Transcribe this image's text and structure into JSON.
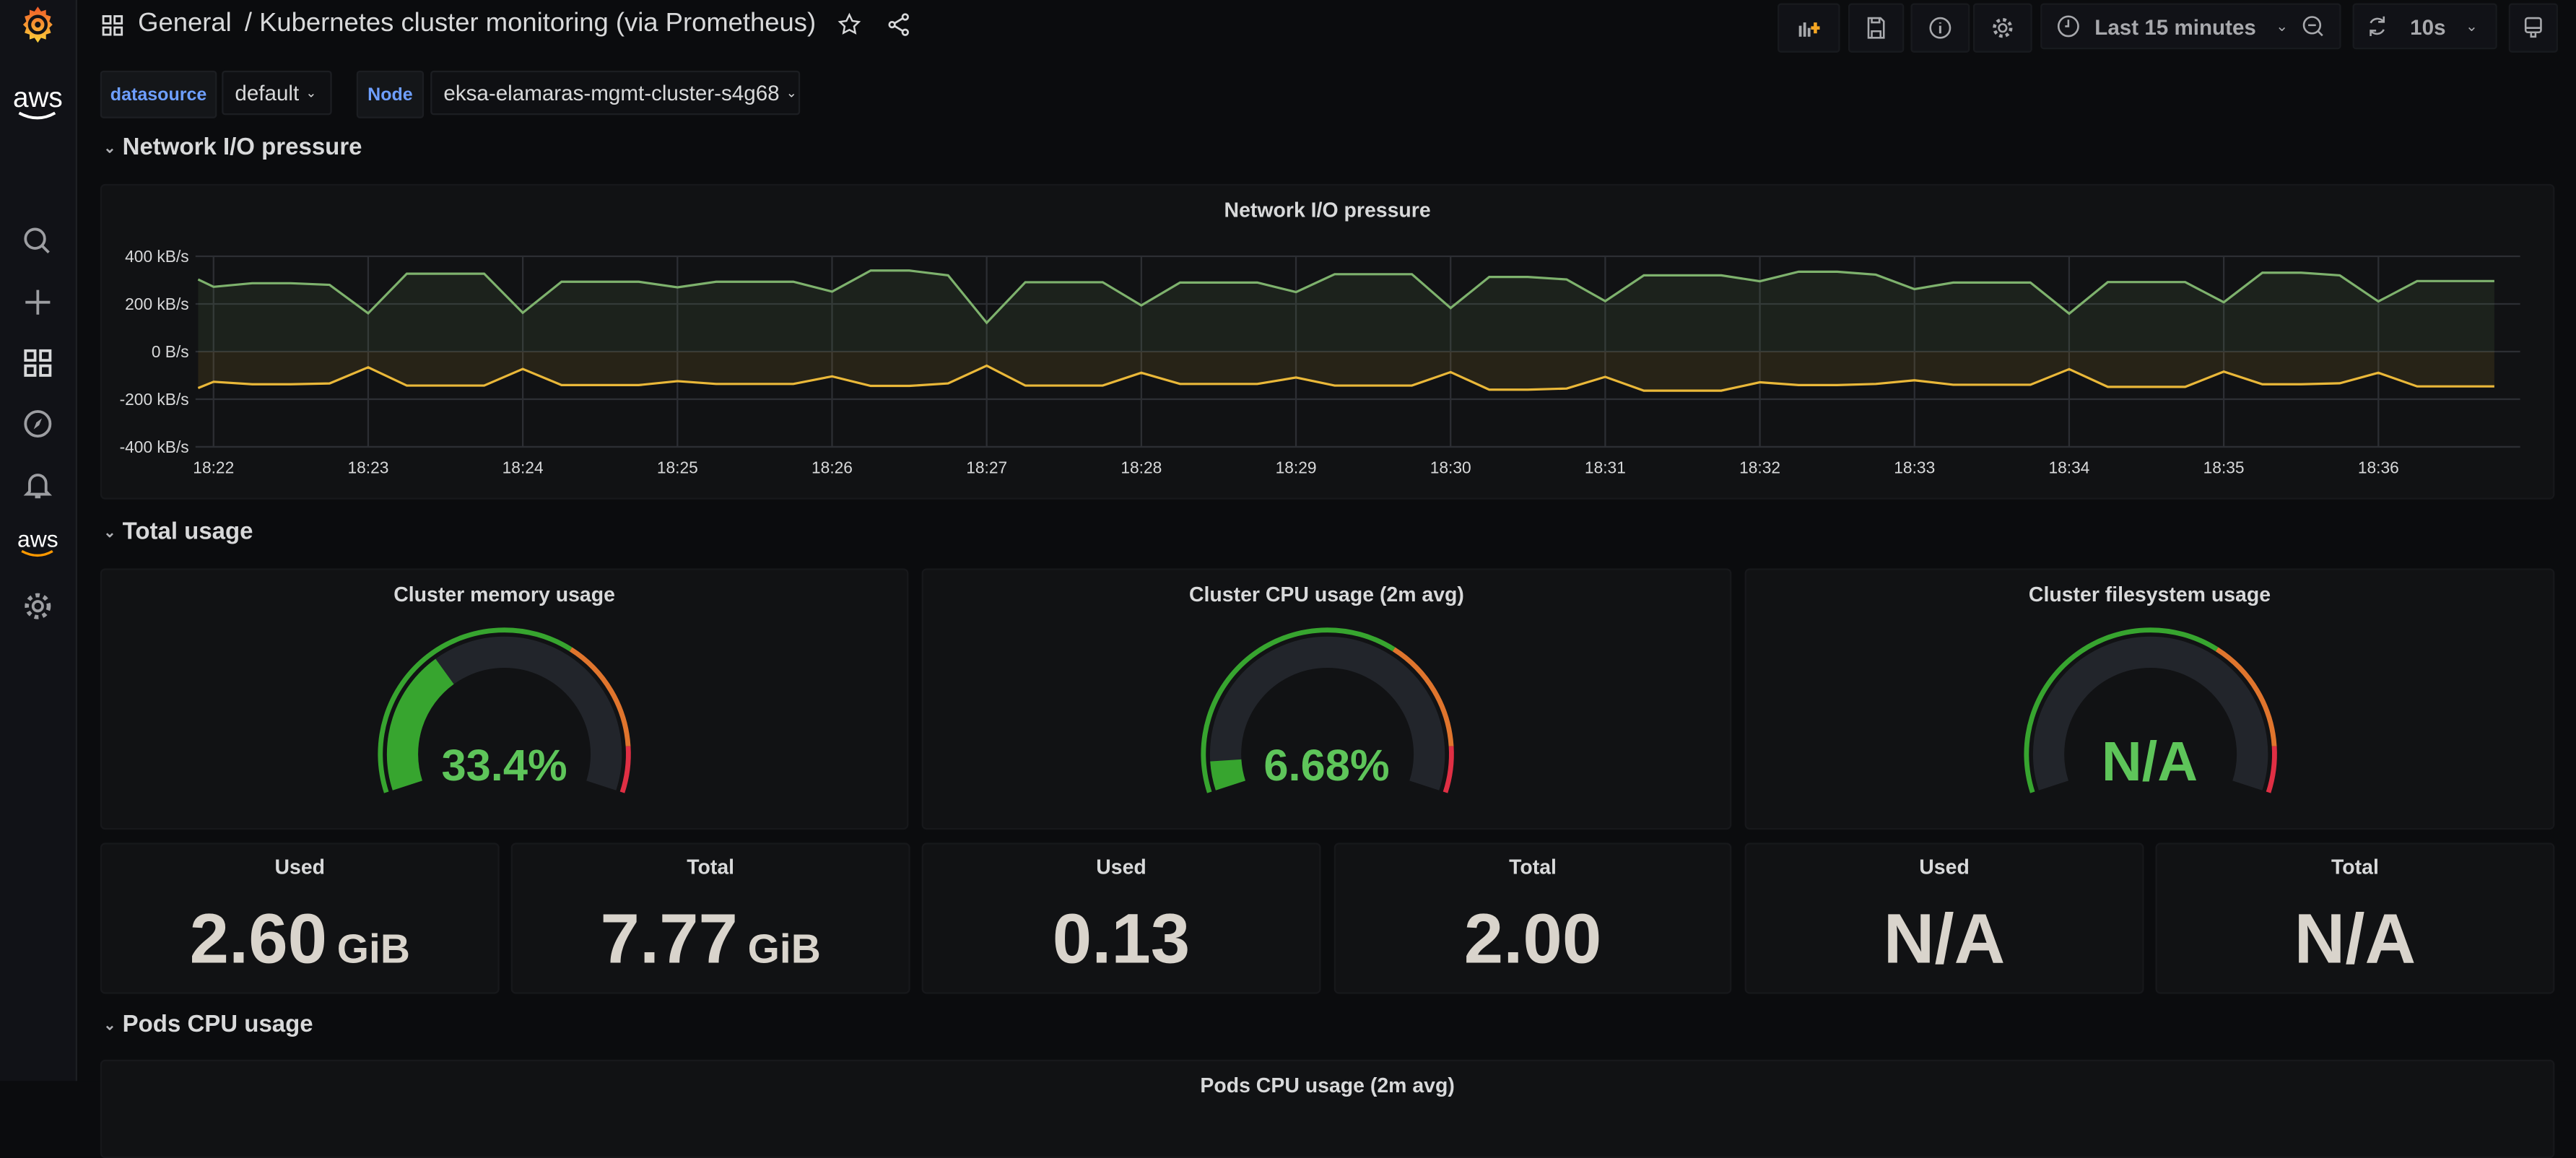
{
  "header": {
    "folder": "General",
    "title": "/ Kubernetes cluster monitoring (via Prometheus)",
    "time_range": "Last 15 minutes",
    "refresh_interval": "10s",
    "buttons": [
      "add-panel-icon",
      "save-icon",
      "info-icon",
      "gear-icon",
      "clock-icon",
      "zoom-out-icon",
      "refresh-icon",
      "tv-mode-icon"
    ]
  },
  "sidebar": {
    "items": [
      "grafana-logo",
      "aws-logo",
      "search-icon",
      "plus-icon",
      "dashboards-icon",
      "explore-compass-icon",
      "alert-bell-icon",
      "aws-icon",
      "gear-icon"
    ],
    "aws_text": "aws"
  },
  "variables": [
    {
      "label": "datasource",
      "value": "default"
    },
    {
      "label": "Node",
      "value": "eksa-elamaras-mgmt-cluster-s4g68"
    }
  ],
  "colors": {
    "accent_blue": "#6e9fff",
    "series_green": "#7eb26d",
    "series_yellow": "#eab839",
    "gauge_green": "#37a52f",
    "gauge_orange": "#e0752d",
    "gauge_red": "#e02f44",
    "value_green": "#5ec55a"
  },
  "rows": {
    "network": "Network I/O pressure",
    "total": "Total usage",
    "pods_cpu": "Pods CPU usage"
  },
  "network_panel": {
    "title": "Network I/O pressure"
  },
  "chart_data": {
    "type": "area",
    "title": "Network I/O pressure",
    "y_tick_labels": [
      "400 kB/s",
      "200 kB/s",
      "0 B/s",
      "-200 kB/s",
      "-400 kB/s"
    ],
    "y_ticks": [
      400,
      200,
      0,
      -200,
      -400
    ],
    "ylim": [
      -400,
      400
    ],
    "y_unit": "kB/s",
    "x_tick_labels": [
      "18:22",
      "18:23",
      "18:24",
      "18:25",
      "18:26",
      "18:27",
      "18:28",
      "18:29",
      "18:30",
      "18:31",
      "18:32",
      "18:33",
      "18:34",
      "18:35",
      "18:36"
    ],
    "xlim": [
      "18:21:53",
      "18:36:55"
    ],
    "grid": true,
    "legend": "none",
    "x": [
      "18:21:54",
      "18:22:00",
      "18:22:15",
      "18:22:30",
      "18:22:45",
      "18:23:00",
      "18:23:15",
      "18:23:30",
      "18:23:45",
      "18:24:00",
      "18:24:15",
      "18:24:30",
      "18:24:45",
      "18:25:00",
      "18:25:15",
      "18:25:30",
      "18:25:45",
      "18:26:00",
      "18:26:15",
      "18:26:30",
      "18:26:45",
      "18:27:00",
      "18:27:15",
      "18:27:30",
      "18:27:45",
      "18:28:00",
      "18:28:15",
      "18:28:30",
      "18:28:45",
      "18:29:00",
      "18:29:15",
      "18:29:30",
      "18:29:45",
      "18:30:00",
      "18:30:15",
      "18:30:30",
      "18:30:45",
      "18:31:00",
      "18:31:15",
      "18:31:30",
      "18:31:45",
      "18:32:00",
      "18:32:15",
      "18:32:30",
      "18:32:45",
      "18:33:00",
      "18:33:15",
      "18:33:30",
      "18:33:45",
      "18:34:00",
      "18:34:15",
      "18:34:30",
      "18:34:45",
      "18:35:00",
      "18:35:15",
      "18:35:30",
      "18:35:45",
      "18:36:00",
      "18:36:15",
      "18:36:30",
      "18:36:45"
    ],
    "series": [
      {
        "color": "#7eb26d",
        "values": [
          303,
          272,
          287,
          287,
          280,
          161,
          327,
          327,
          327,
          163,
          293,
          293,
          293,
          270,
          293,
          293,
          293,
          252,
          340,
          340,
          320,
          121,
          291,
          291,
          291,
          194,
          290,
          290,
          290,
          250,
          325,
          325,
          325,
          183,
          313,
          313,
          303,
          212,
          320,
          320,
          320,
          295,
          335,
          335,
          323,
          262,
          290,
          290,
          290,
          159,
          292,
          292,
          292,
          207,
          331,
          331,
          320,
          210,
          296,
          296,
          296
        ]
      },
      {
        "color": "#eab839",
        "values": [
          -153,
          -127,
          -137,
          -137,
          -134,
          -66,
          -143,
          -143,
          -143,
          -73,
          -141,
          -141,
          -141,
          -124,
          -136,
          -136,
          -136,
          -104,
          -144,
          -144,
          -134,
          -59,
          -143,
          -143,
          -143,
          -89,
          -136,
          -136,
          -136,
          -109,
          -143,
          -143,
          -143,
          -86,
          -160,
          -160,
          -155,
          -106,
          -164,
          -164,
          -164,
          -129,
          -141,
          -141,
          -136,
          -121,
          -139,
          -139,
          -139,
          -74,
          -148,
          -148,
          -148,
          -84,
          -137,
          -137,
          -133,
          -89,
          -146,
          -146,
          -146
        ]
      }
    ]
  },
  "gauges": [
    {
      "title": "Cluster memory usage",
      "display": "33.4%",
      "percent": 33.4,
      "thresholds": [
        65,
        90
      ]
    },
    {
      "title": "Cluster CPU usage (2m avg)",
      "display": "6.68%",
      "percent": 6.68,
      "thresholds": [
        65,
        90
      ]
    },
    {
      "title": "Cluster filesystem usage",
      "display": "N/A",
      "percent": null,
      "thresholds": [
        65,
        90
      ]
    }
  ],
  "stats": [
    {
      "label": "Used",
      "value": "2.60",
      "unit": "GiB"
    },
    {
      "label": "Total",
      "value": "7.77",
      "unit": "GiB"
    },
    {
      "label": "Used",
      "value": "0.13",
      "unit": ""
    },
    {
      "label": "Total",
      "value": "2.00",
      "unit": ""
    },
    {
      "label": "Used",
      "value": "N/A",
      "unit": ""
    },
    {
      "label": "Total",
      "value": "N/A",
      "unit": ""
    }
  ],
  "pods_cpu_panel": {
    "title": "Pods CPU usage (2m avg)"
  }
}
